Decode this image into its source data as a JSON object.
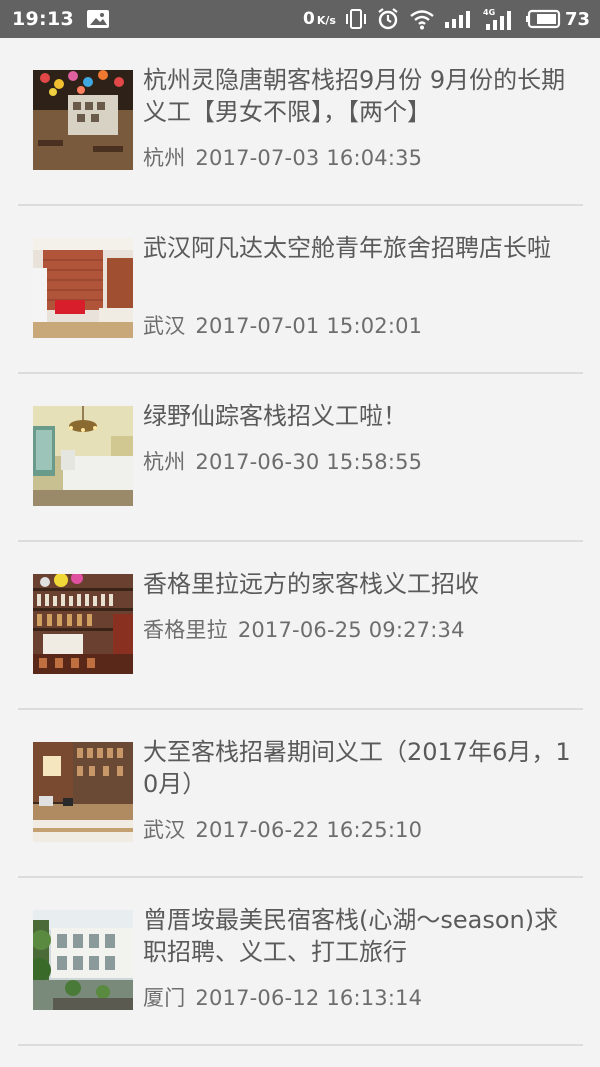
{
  "status_bar": {
    "time": "19:13",
    "net_speed_value": "0",
    "net_speed_unit": "K/s",
    "network_type": "4G",
    "battery_level": "73",
    "icons": [
      "image-notification-icon",
      "vibrate-icon",
      "alarm-icon",
      "wifi-icon",
      "signal-icon",
      "signal-4g-icon",
      "battery-icon"
    ]
  },
  "listings": [
    {
      "title": "杭州灵隐唐朝客栈招9月份 9月份的长期义工【男女不限】，【两个】",
      "city": "杭州",
      "datetime": "2017-07-03 16:04:35",
      "thumbnail": "cafe-with-lanterns"
    },
    {
      "title": "武汉阿凡达太空舱青年旅舍招聘店长啦",
      "city": "武汉",
      "datetime": "2017-07-01 15:02:01",
      "thumbnail": "brick-wall-lobby"
    },
    {
      "title": "绿野仙踪客栈招义工啦！",
      "city": "杭州",
      "datetime": "2017-06-30 15:58:55",
      "thumbnail": "bedroom-chandelier"
    },
    {
      "title": "香格里拉远方的家客栈义工招收",
      "city": "香格里拉",
      "datetime": "2017-06-25 09:27:34",
      "thumbnail": "bar-shelves"
    },
    {
      "title": "大至客栈招暑期间义工（2017年6月，10月）",
      "city": "武汉",
      "datetime": "2017-06-22 16:25:10",
      "thumbnail": "cafe-counter"
    },
    {
      "title": "曾厝垵最美民宿客栈(心湖～season)求职招聘、义工、打工旅行",
      "city": "厦门",
      "datetime": "2017-06-12 16:13:14",
      "thumbnail": "courtyard-building"
    }
  ]
}
